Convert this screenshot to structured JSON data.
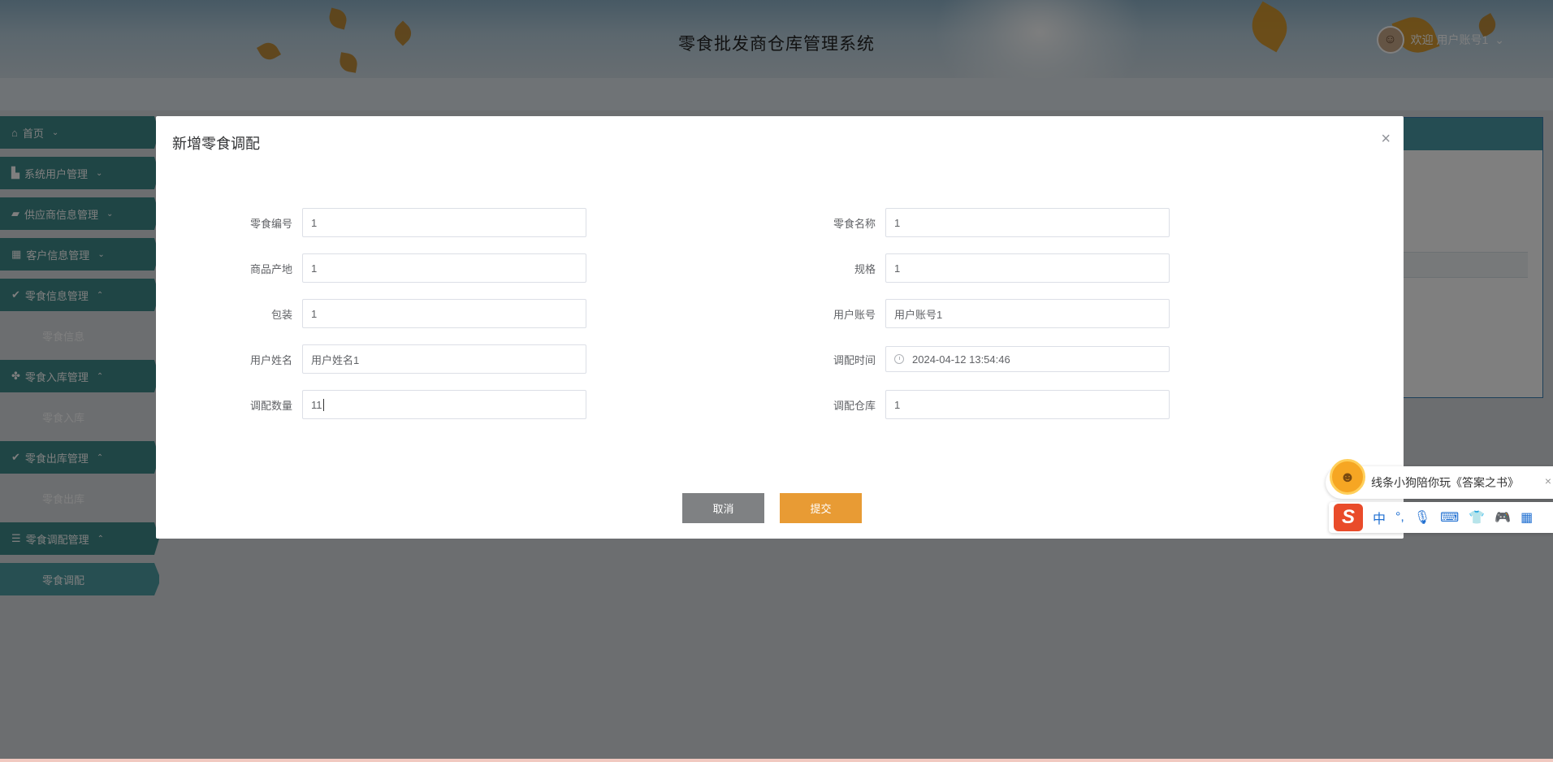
{
  "header": {
    "title": "零食批发商仓库管理系统",
    "user_label": "欢迎 用户账号1"
  },
  "sidebar": {
    "items": [
      {
        "label": "首页",
        "icon": "home-icon"
      },
      {
        "label": "系统用户管理",
        "icon": "user-icon"
      },
      {
        "label": "供应商信息管理",
        "icon": "folder-icon"
      },
      {
        "label": "客户信息管理",
        "icon": "grid-icon"
      },
      {
        "label": "零食信息管理",
        "icon": "check-circle-icon",
        "sub": "零食信息"
      },
      {
        "label": "零食入库管理",
        "icon": "cluster-icon",
        "sub": "零食入库"
      },
      {
        "label": "零食出库管理",
        "icon": "check-circle-icon",
        "sub": "零食出库"
      },
      {
        "label": "零食调配管理",
        "icon": "list-icon",
        "sub": "零食调配"
      }
    ]
  },
  "dialog": {
    "title": "新增零食调配",
    "fields": {
      "snack_code": {
        "label": "零食编号",
        "value": "1"
      },
      "snack_name": {
        "label": "零食名称",
        "value": "1"
      },
      "origin": {
        "label": "商品产地",
        "value": "1"
      },
      "spec": {
        "label": "规格",
        "value": "1"
      },
      "packaging": {
        "label": "包装",
        "value": "1"
      },
      "user_account": {
        "label": "用户账号",
        "value": "用户账号1"
      },
      "user_name": {
        "label": "用户姓名",
        "value": "用户姓名1"
      },
      "transfer_time": {
        "label": "调配时间",
        "value": "2024-04-12 13:54:46"
      },
      "transfer_qty": {
        "label": "调配数量",
        "value": "11"
      },
      "transfer_warehouse": {
        "label": "调配仓库",
        "value": "1"
      }
    },
    "cancel_label": "取消",
    "submit_label": "提交"
  },
  "ime": {
    "bubble_text": "线条小狗陪你玩《答案之书》",
    "mode": "中",
    "punct": "°,"
  }
}
